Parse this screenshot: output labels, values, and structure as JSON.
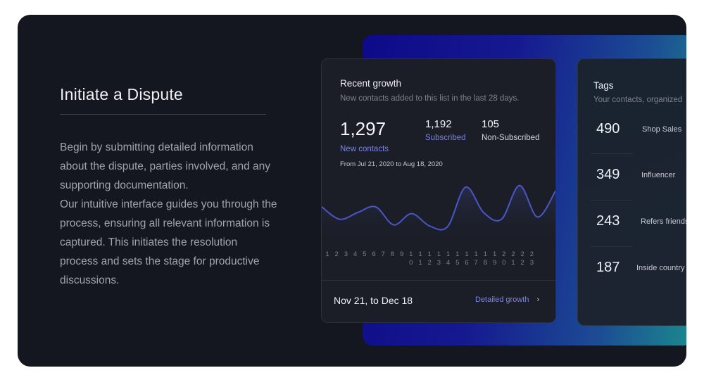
{
  "intro": {
    "title": "Initiate a Dispute",
    "paragraph1": "Begin by submitting detailed information about the dispute, parties involved, and any supporting documentation.",
    "paragraph2": "Our intuitive interface guides you through the process, ensuring all relevant information is captured. This initiates the resolution process and sets the stage for productive discussions."
  },
  "growth": {
    "title": "Recent growth",
    "subtitle": "New contacts added to this list in the last 28 days.",
    "new_contacts_value": "1,297",
    "new_contacts_label": "New contacts",
    "subscribed_value": "1,192",
    "subscribed_label": "Subscribed",
    "non_subscribed_value": "105",
    "non_subscribed_label": "Non-Subscribed",
    "date_range": "From Jul 21, 2020 to Aug 18, 2020",
    "footer_range": "Nov 21, to Dec 18",
    "footer_link": "Detailed growth",
    "x_ticks": [
      "1",
      "2",
      "3",
      "4",
      "5",
      "6",
      "7",
      "8",
      "9",
      "10",
      "11",
      "12",
      "13",
      "14",
      "15",
      "16",
      "17",
      "18",
      "19",
      "20",
      "21",
      "22",
      "23"
    ],
    "series_values": [
      40,
      18,
      30,
      40,
      8,
      28,
      6,
      5,
      75,
      30,
      18,
      78,
      22,
      68
    ]
  },
  "tags": {
    "title": "Tags",
    "subtitle": "Your contacts, organized",
    "items": [
      {
        "count": "490",
        "name": "Shop Sales"
      },
      {
        "count": "349",
        "name": "Influencer"
      },
      {
        "count": "243",
        "name": "Refers friends"
      },
      {
        "count": "187",
        "name": "Inside country"
      }
    ]
  },
  "colors": {
    "card_bg": "#14171f",
    "panel_bg": "#1b1e27",
    "accent": "#7b84e3",
    "line": "#4a56c8"
  }
}
